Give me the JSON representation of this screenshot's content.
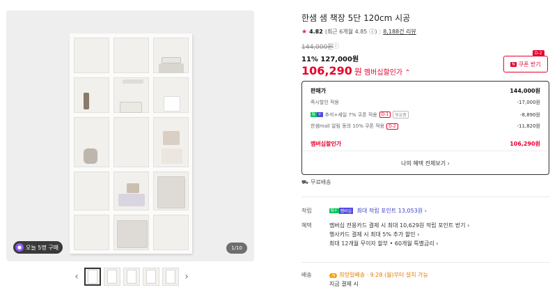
{
  "gallery": {
    "today_badge": "오늘 5명 구매",
    "counter": "1/10",
    "prev_arrow": "‹",
    "next_arrow": "›"
  },
  "product": {
    "title": "한샘 샘 책장 5단 120cm 시공",
    "rating": {
      "score": "4.82",
      "recent": "(최근 6개월 4.85",
      "reviews": "8,188건 리뷰"
    },
    "original_price": "144,000원",
    "sale": "11% 127,000원",
    "member_price": "106,290",
    "won": "원",
    "member_label": "멤버십할인가 ⌃",
    "coupon": {
      "label": "쿠폰 받기",
      "n": "N",
      "dday": "D-2"
    }
  },
  "benefit_box": {
    "rows": [
      {
        "label": "판매가",
        "value": "144,000원"
      },
      {
        "label": "즉시할인 적용",
        "value": "-17,000원"
      },
      {
        "label": "추석+세일 7% 쿠폰 적용",
        "tag": "D-1",
        "tag2": "보유중",
        "value": "-8,890원"
      },
      {
        "label": "한샘mall 알림 동의 10% 쿠폰 적용",
        "tag": "D-2",
        "value": "-11,820원"
      },
      {
        "label": "멤버십할인가",
        "value": "106,290원"
      }
    ],
    "all_benefit": "나의 혜택 전체보기 ›"
  },
  "free_shipping": "무료배송",
  "points": {
    "key": "적립",
    "text": "최대 적립 포인트 13,053원 ›"
  },
  "benefits": {
    "key": "혜택",
    "lines": [
      "멤버십 전용카드 결제 시 최대 10,629원 적립 포인트 받기 ›",
      "행사카드 결제 시 최대 5% 추가 할인 ›",
      "최대 12개월 무이자 할부 • 60개월 특별금리 ›"
    ]
  },
  "delivery": {
    "key": "배송",
    "line1": "희망일배송 · 9.28 (월)부터 설치 가능",
    "line2": "지금 결제 시"
  },
  "colors": {
    "accent": "#e8002d",
    "naver_green": "#03c75a",
    "orange": "#e07c00"
  }
}
